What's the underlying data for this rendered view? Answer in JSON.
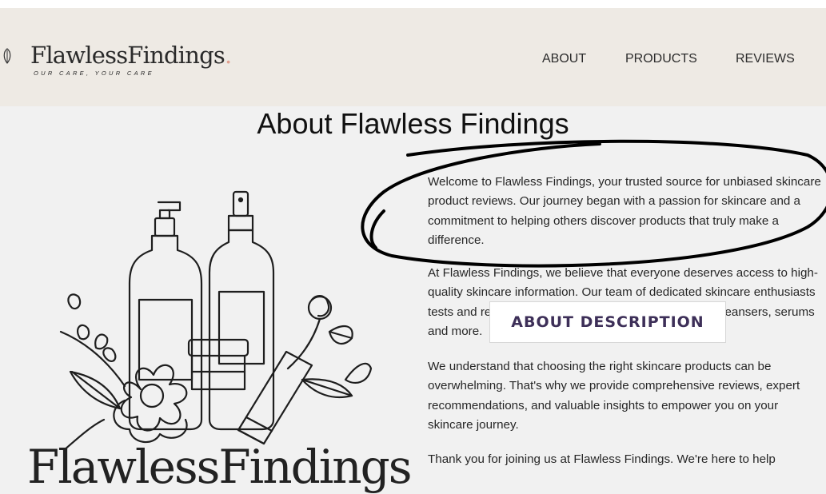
{
  "header": {
    "logo_title": "FlawlessFindings",
    "logo_dot": ".",
    "logo_tagline": "OUR CARE, YOUR CARE",
    "nav": [
      "ABOUT",
      "PRODUCTS",
      "REVIEWS"
    ]
  },
  "main": {
    "title": "About Flawless Findings",
    "brand_large": "FlawlessFindings",
    "paragraphs": [
      "Welcome to Flawless Findings, your trusted source for unbiased skincare product reviews. Our journey began with a passion for skincare and a commitment to helping others discover products that truly make a difference.",
      "At Flawless Findings, we believe that everyone deserves access to high-quality skincare information. Our team of dedicated skincare enthusiasts tests and reviews a wide range of products, including cleansers, serums and more.",
      "We understand that choosing the right skincare products can be overwhelming. That's why we provide comprehensive reviews, expert recommendations, and valuable insights to empower you on your skincare journey.",
      "Thank you for joining us at Flawless Findings. We're here to help"
    ]
  },
  "annotation": {
    "label": "ABOUT DESCRIPTION",
    "color": "#3d2f58"
  },
  "colors": {
    "header_bg": "#eeeae4",
    "page_bg": "#f1f1f1",
    "accent": "#e0a090"
  }
}
